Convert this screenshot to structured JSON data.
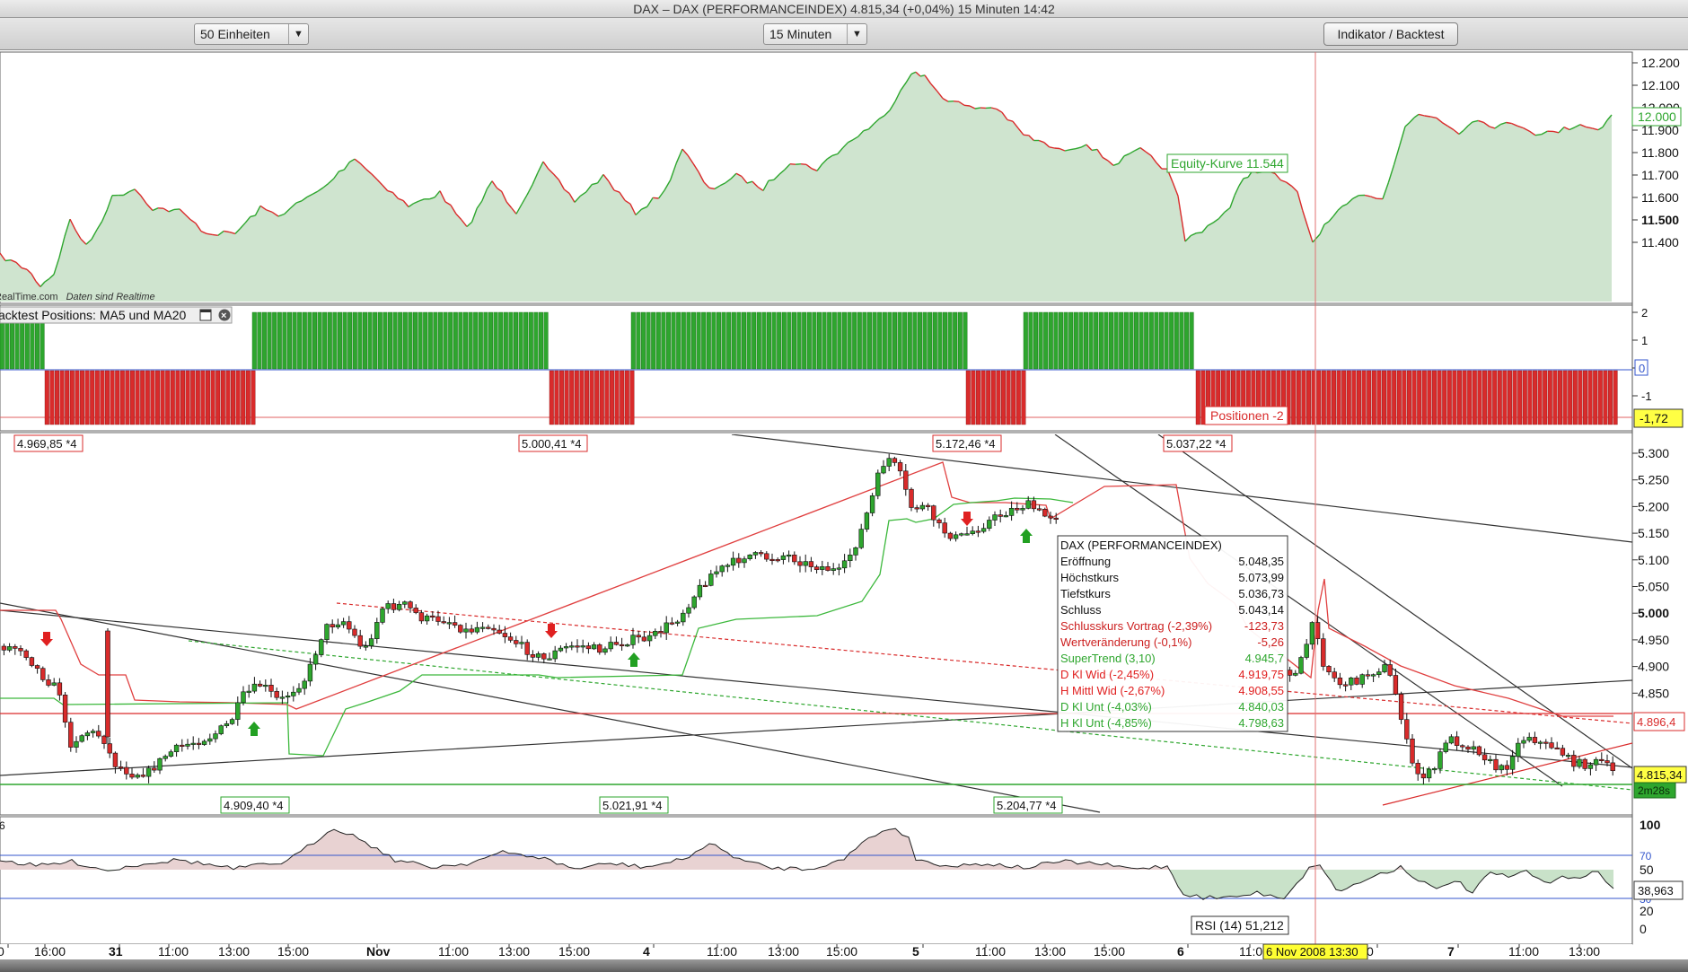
{
  "window": {
    "title": "DAX – DAX (PERFORMANCEINDEX)    4.815,34 (+0,04%)    15 Minuten  14:42"
  },
  "toolbar": {
    "units_select": "50 Einheiten",
    "interval_select": "15 Minuten",
    "indicator_button": "Indikator / Backtest"
  },
  "equity_panel": {
    "axis_ticks": [
      "12.200",
      "12.100",
      "12.000",
      "11.900",
      "11.800",
      "11.700",
      "11.600",
      "11.500",
      "11.400"
    ],
    "current_value_tag": "12.000",
    "label": "Equity-Kurve 11.544",
    "source_note": "RealTime.com",
    "source_note_italic": "Daten sind Realtime"
  },
  "positions_panel": {
    "title": "acktest Positions: MA5 und MA20",
    "axis_ticks": [
      "2",
      "1",
      "0",
      "-1"
    ],
    "current_value_tag": "-1,72",
    "label": "Positionen -2"
  },
  "price_panel": {
    "axis_ticks": [
      "5.300",
      "5.250",
      "5.200",
      "5.150",
      "5.100",
      "5.050",
      "5.000",
      "4.950",
      "4.900",
      "4.850"
    ],
    "high_labels": [
      "4.969,85 *4",
      "5.000,41 *4",
      "5.172,46 *4",
      "5.037,22 *4"
    ],
    "low_labels": [
      "4.909,40 *4",
      "5.021,91 *4",
      "5.204,77 *4"
    ],
    "tag_resistance": "4.896,4",
    "tag_last": "4.815,34",
    "tag_timer": "2m28s",
    "tooltip": {
      "title": "DAX (PERFORMANCEINDEX)",
      "rows": [
        {
          "label": "Eröffnung",
          "value": "5.048,35"
        },
        {
          "label": "Höchstkurs",
          "value": "5.073,99"
        },
        {
          "label": "Tiefstkurs",
          "value": "5.036,73"
        },
        {
          "label": "Schluss",
          "value": "5.043,14"
        },
        {
          "label": "Schlusskurs Vortrag (-2,39%)",
          "value": "-123,73"
        },
        {
          "label": "Wertveränderung (-0,1%)",
          "value": "-5,26"
        },
        {
          "label": "SuperTrend (3,10)",
          "value": "4.945,7"
        },
        {
          "label": "D Kl Wid (-2,45%)",
          "value": "4.919,75"
        },
        {
          "label": "H Mittl Wid (-2,67%)",
          "value": "4.908,55"
        },
        {
          "label": "D Kl Unt (-4,03%)",
          "value": "4.840,03"
        },
        {
          "label": "H Kl Unt (-4,85%)",
          "value": "4.798,63"
        }
      ]
    }
  },
  "rsi_panel": {
    "left_fragment": "6",
    "axis_ticks": [
      "100",
      "70",
      "50",
      "30",
      "20",
      "0"
    ],
    "current_value_tag": "38,963",
    "label": "RSI (14) 51,212"
  },
  "time_axis": {
    "labels": [
      "0",
      "16:00",
      "31",
      "11:00",
      "13:00",
      "15:00",
      "Nov",
      "11:00",
      "13:00",
      "15:00",
      "4",
      "11:00",
      "13:00",
      "15:00",
      "5",
      "11:00",
      "13:00",
      "15:00",
      "6",
      "11:00",
      "0",
      "7",
      "11:00",
      "13:00"
    ],
    "cursor_label": "6 Nov 2008 13:30"
  },
  "colors": {
    "up": "#2ea62e",
    "down": "#d92b2b",
    "equity_fill": "#cfe4cf",
    "rsi_fill_low": "#e8d2d2",
    "rsi_fill_high": "#c9e2c9"
  }
}
